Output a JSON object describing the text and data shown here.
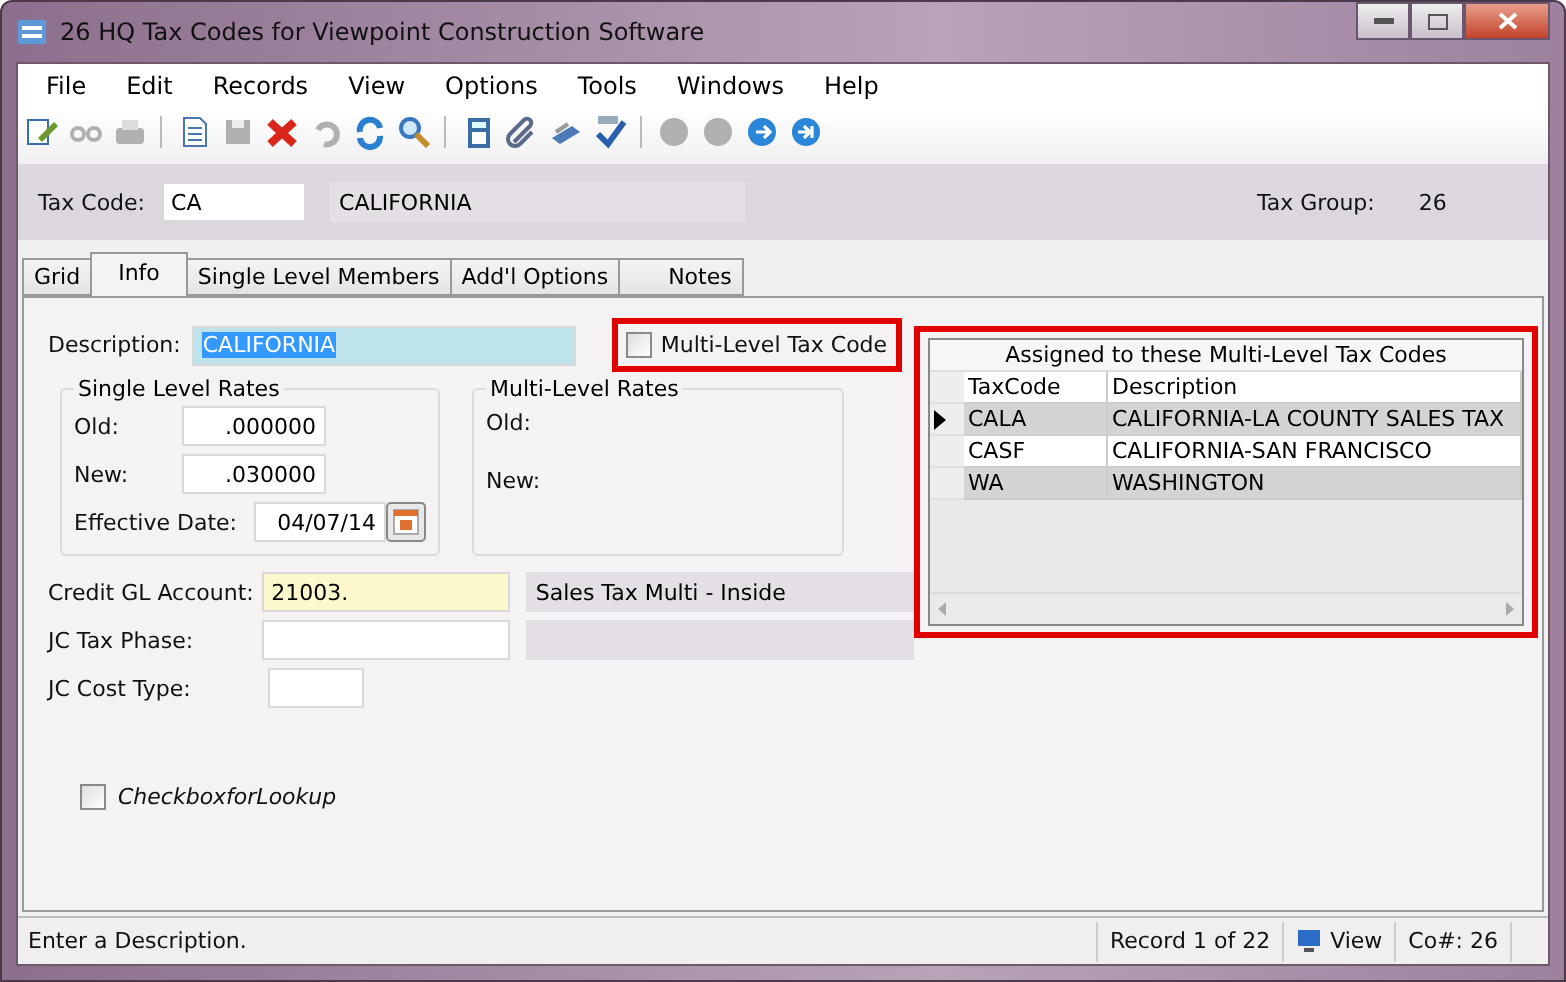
{
  "window": {
    "title": "26 HQ Tax Codes for Viewpoint Construction Software"
  },
  "menu": [
    "File",
    "Edit",
    "Records",
    "View",
    "Options",
    "Tools",
    "Windows",
    "Help"
  ],
  "toolbar": [
    {
      "kind": "edit",
      "disabled": false
    },
    {
      "kind": "glasses",
      "disabled": true
    },
    {
      "kind": "printer",
      "disabled": true
    },
    {
      "kind": "sep"
    },
    {
      "kind": "page",
      "disabled": false
    },
    {
      "kind": "save",
      "disabled": true
    },
    {
      "kind": "delete",
      "disabled": false
    },
    {
      "kind": "undo",
      "disabled": true
    },
    {
      "kind": "refresh",
      "disabled": false
    },
    {
      "kind": "search",
      "disabled": false
    },
    {
      "kind": "sep"
    },
    {
      "kind": "calculator",
      "disabled": false
    },
    {
      "kind": "clip",
      "disabled": false
    },
    {
      "kind": "scanner",
      "disabled": false
    },
    {
      "kind": "spell",
      "disabled": false
    },
    {
      "kind": "sep"
    },
    {
      "kind": "first",
      "disabled": true
    },
    {
      "kind": "prev",
      "disabled": true
    },
    {
      "kind": "next",
      "disabled": false
    },
    {
      "kind": "last",
      "disabled": false
    }
  ],
  "header": {
    "tax_code_label": "Tax Code:",
    "tax_code": "CA",
    "tax_code_name": "CALIFORNIA",
    "tax_group_label": "Tax Group:",
    "tax_group": "26"
  },
  "tabs": [
    {
      "label": "Grid",
      "selected": false
    },
    {
      "label": "Info",
      "selected": true
    },
    {
      "label": "Single Level Members",
      "selected": false
    },
    {
      "label": "Add'l Options",
      "selected": false
    },
    {
      "label": "Notes",
      "selected": false
    }
  ],
  "form": {
    "description_label": "Description:",
    "description": "CALIFORNIA",
    "multi_level": {
      "label": "Multi-Level Tax Code",
      "checked": false
    },
    "single_level_rates": {
      "title": "Single Level Rates",
      "old_label": "Old:",
      "old": ".000000",
      "new_label": "New:",
      "new": ".030000",
      "date_label": "Effective Date:",
      "date": "04/07/14"
    },
    "multi_level_rates": {
      "title": "Multi-Level Rates",
      "old_label": "Old:",
      "new_label": "New:"
    },
    "credit_gl_label": "Credit GL Account:",
    "credit_gl": "21003.",
    "credit_gl_desc": "Sales Tax Multi - Inside",
    "jc_tax_phase_label": "JC Tax Phase:",
    "jc_cost_type_label": "JC Cost Type:",
    "lookup": {
      "label": "CheckboxforLookup",
      "checked": false
    }
  },
  "assigned": {
    "title": "Assigned to these Multi-Level Tax Codes",
    "columns": [
      "TaxCode",
      "Description"
    ],
    "rows": [
      {
        "code": "CALA",
        "description": "CALIFORNIA-LA COUNTY SALES TAX",
        "selected": true
      },
      {
        "code": "CASF",
        "description": "CALIFORNIA-SAN FRANCISCO",
        "selected": false
      },
      {
        "code": "WA",
        "description": "WASHINGTON",
        "selected": false
      }
    ]
  },
  "status_bar": {
    "message": "Enter a Description.",
    "record": "Record 1 of 22",
    "mode": "View",
    "company": "Co#: 26"
  }
}
